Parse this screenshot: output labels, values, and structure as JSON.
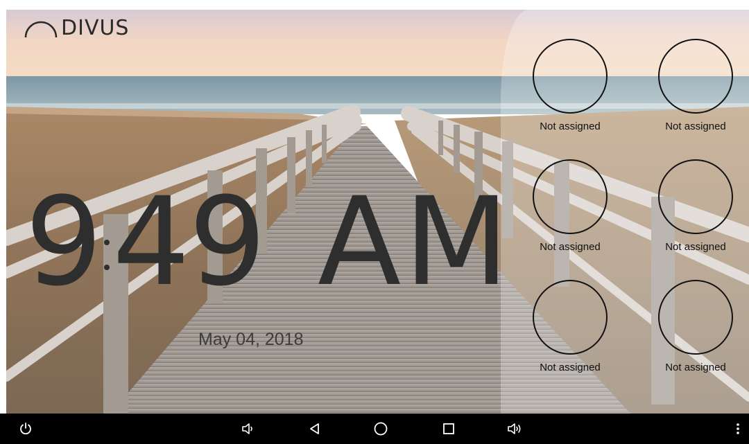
{
  "app": {
    "logo_text": "DIVUS"
  },
  "clock": {
    "hours": "9",
    "minutes": "49",
    "meridiem": "AM"
  },
  "date": "May 04, 2018",
  "quick_slots": [
    {
      "label": "Not assigned"
    },
    {
      "label": "Not assigned"
    },
    {
      "label": "Not assigned"
    },
    {
      "label": "Not assigned"
    },
    {
      "label": "Not assigned"
    },
    {
      "label": "Not assigned"
    }
  ],
  "navbar": {
    "buttons": [
      "power-icon",
      "volume-down-icon",
      "back-icon",
      "home-icon",
      "recents-icon",
      "volume-up-icon",
      "more-options-icon"
    ]
  }
}
